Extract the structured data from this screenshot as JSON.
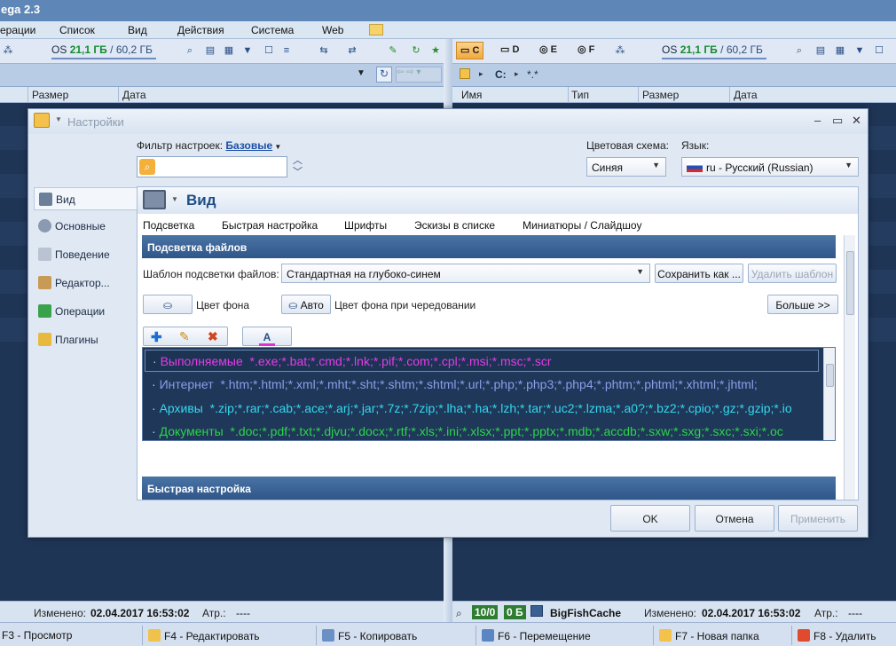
{
  "app": {
    "title": "ega 2.3"
  },
  "menu": [
    "ерации",
    "Список",
    "Вид",
    "Действия",
    "Система",
    "Web"
  ],
  "left_panel": {
    "disk_name": "OS",
    "disk_free": "21,1 ГБ",
    "disk_sep": " / ",
    "disk_total": "60,2 ГБ",
    "columns": [
      "Размер",
      "Дата"
    ]
  },
  "right_panel": {
    "drives": [
      "C",
      "D",
      "E",
      "F"
    ],
    "disk_name": "OS",
    "disk_free": "21,1 ГБ",
    "disk_sep": " / ",
    "disk_total": "60,2 ГБ",
    "path_drive": "C:",
    "path_mask": "*.*",
    "columns": [
      "Имя",
      "Тип",
      "Размер",
      "Дата"
    ]
  },
  "status": {
    "left": {
      "modified_label": "Изменено:",
      "modified_value": "02.04.2017 16:53:02",
      "attr_label": "Атр.:",
      "attr_value": "----"
    },
    "right": {
      "selected": "10/0",
      "size": "0 Б",
      "name": "BigFishCache",
      "modified_label": "Изменено:",
      "modified_value": "02.04.2017 16:53:02",
      "attr_label": "Атр.:",
      "attr_value": "----"
    }
  },
  "fkeys": [
    "F3 - Просмотр",
    "F4 - Редактировать",
    "F5 - Копировать",
    "F6 - Перемещение",
    "F7 - Новая папка",
    "F8 - Удалить"
  ],
  "dialog": {
    "title": "Настройки",
    "filter_label": "Фильтр настроек:",
    "filter_value": "Базовые",
    "color_scheme_label": "Цветовая схема:",
    "color_scheme_value": "Синяя",
    "language_label": "Язык:",
    "language_value": "ru - Русский (Russian)",
    "nav": [
      "Вид",
      "Основные",
      "Поведение",
      "Редактор...",
      "Операции",
      "Плагины"
    ],
    "page_title": "Вид",
    "tabs": [
      "Подсветка",
      "Быстрая настройка",
      "Шрифты",
      "Эскизы в списке",
      "Миниатюры / Слайдшоу"
    ],
    "section1": "Подсветка файлов",
    "template_label": "Шаблон подсветки файлов:",
    "template_value": "Стандартная на глубоко-синем",
    "save_button": "Сохранить как ...",
    "delete_button": "Удалить шаблон",
    "bg_color_label": "Цвет фона",
    "auto_button": "Авто",
    "alt_bg_label": "Цвет фона при чередовании",
    "more_button": "Больше >>",
    "rules": [
      {
        "name": "Выполняемые",
        "mask": "*.exe;*.bat;*.cmd;*.lnk;*.pif;*.com;*.cpl;*.msi;*.msc;*.scr",
        "color": "#e23de6"
      },
      {
        "name": "Интернет",
        "mask": "*.htm;*.html;*.xml;*.mht;*.sht;*.shtm;*.shtml;*.url;*.php;*.php3;*.php4;*.phtm;*.phtml;*.xhtml;*.jhtml;",
        "color": "#8a9fe8"
      },
      {
        "name": "Архивы",
        "mask": "*.zip;*.rar;*.cab;*.ace;*.arj;*.jar;*.7z;*.7zip;*.lha;*.ha;*.lzh;*.tar;*.uc2;*.lzma;*.a0?;*.bz2;*.cpio;*.gz;*.gzip;*.io",
        "color": "#34d8ee"
      },
      {
        "name": "Документы",
        "mask": "*.doc;*.pdf;*.txt;*.djvu;*.docx;*.rtf;*.xls;*.ini;*.xlsx;*.ppt;*.pptx;*.mdb;*.accdb;*.sxw;*.sxg;*.sxc;*.sxi;*.oc",
        "color": "#2bd64a"
      }
    ],
    "section2": "Быстрая настройка",
    "ok_button": "OK",
    "cancel_button": "Отмена",
    "apply_button": "Применить"
  }
}
